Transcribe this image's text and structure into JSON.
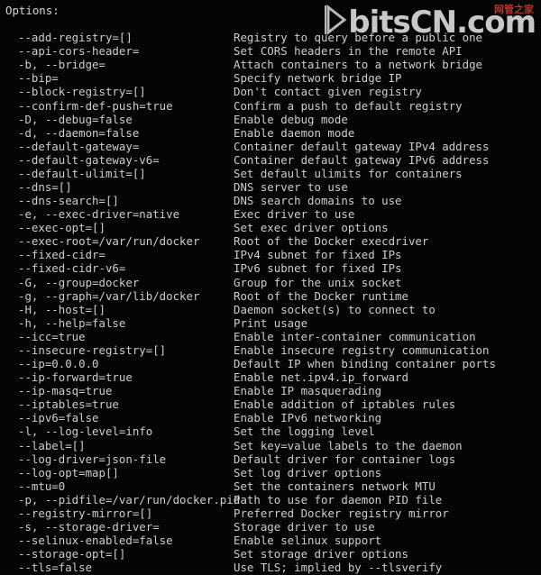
{
  "terminal": {
    "heading": "Options:",
    "blank_line": "",
    "options": [
      {
        "flag": "--add-registry=[]",
        "desc": "Registry to query before a public one"
      },
      {
        "flag": "--api-cors-header=",
        "desc": "Set CORS headers in the remote API"
      },
      {
        "flag": "-b, --bridge=",
        "desc": "Attach containers to a network bridge"
      },
      {
        "flag": "--bip=",
        "desc": "Specify network bridge IP"
      },
      {
        "flag": "--block-registry=[]",
        "desc": "Don't contact given registry"
      },
      {
        "flag": "--confirm-def-push=true",
        "desc": "Confirm a push to default registry"
      },
      {
        "flag": "-D, --debug=false",
        "desc": "Enable debug mode"
      },
      {
        "flag": "-d, --daemon=false",
        "desc": "Enable daemon mode"
      },
      {
        "flag": "--default-gateway=",
        "desc": "Container default gateway IPv4 address"
      },
      {
        "flag": "--default-gateway-v6=",
        "desc": "Container default gateway IPv6 address"
      },
      {
        "flag": "--default-ulimit=[]",
        "desc": "Set default ulimits for containers"
      },
      {
        "flag": "--dns=[]",
        "desc": "DNS server to use"
      },
      {
        "flag": "--dns-search=[]",
        "desc": "DNS search domains to use"
      },
      {
        "flag": "-e, --exec-driver=native",
        "desc": "Exec driver to use"
      },
      {
        "flag": "--exec-opt=[]",
        "desc": "Set exec driver options"
      },
      {
        "flag": "--exec-root=/var/run/docker",
        "desc": "Root of the Docker execdriver"
      },
      {
        "flag": "--fixed-cidr=",
        "desc": "IPv4 subnet for fixed IPs"
      },
      {
        "flag": "--fixed-cidr-v6=",
        "desc": "IPv6 subnet for fixed IPs"
      },
      {
        "flag": "-G, --group=docker",
        "desc": "Group for the unix socket"
      },
      {
        "flag": "-g, --graph=/var/lib/docker",
        "desc": "Root of the Docker runtime"
      },
      {
        "flag": "-H, --host=[]",
        "desc": "Daemon socket(s) to connect to"
      },
      {
        "flag": "-h, --help=false",
        "desc": "Print usage"
      },
      {
        "flag": "--icc=true",
        "desc": "Enable inter-container communication"
      },
      {
        "flag": "--insecure-registry=[]",
        "desc": "Enable insecure registry communication"
      },
      {
        "flag": "--ip=0.0.0.0",
        "desc": "Default IP when binding container ports"
      },
      {
        "flag": "--ip-forward=true",
        "desc": "Enable net.ipv4.ip_forward"
      },
      {
        "flag": "--ip-masq=true",
        "desc": "Enable IP masquerading"
      },
      {
        "flag": "--iptables=true",
        "desc": "Enable addition of iptables rules"
      },
      {
        "flag": "--ipv6=false",
        "desc": "Enable IPv6 networking"
      },
      {
        "flag": "-l, --log-level=info",
        "desc": "Set the logging level"
      },
      {
        "flag": "--label=[]",
        "desc": "Set key=value labels to the daemon"
      },
      {
        "flag": "--log-driver=json-file",
        "desc": "Default driver for container logs"
      },
      {
        "flag": "--log-opt=map[]",
        "desc": "Set log driver options"
      },
      {
        "flag": "--mtu=0",
        "desc": "Set the containers network MTU"
      },
      {
        "flag": "-p, --pidfile=/var/run/docker.pid",
        "desc": "Path to use for daemon PID file"
      },
      {
        "flag": "--registry-mirror=[]",
        "desc": "Preferred Docker registry mirror"
      },
      {
        "flag": "-s, --storage-driver=",
        "desc": "Storage driver to use"
      },
      {
        "flag": "--selinux-enabled=false",
        "desc": "Enable selinux support"
      },
      {
        "flag": "--storage-opt=[]",
        "desc": "Set storage driver options"
      },
      {
        "flag": "--tls=false",
        "desc": "Use TLS; implied by --tlsverify"
      }
    ]
  },
  "watermark": {
    "brand": "bitsCN",
    "tld": ".com",
    "chinese": "网管之家",
    "logo_icon": "play-triangle-icon",
    "accent_color": "#c0392b",
    "text_color": "#f2f2f2"
  },
  "colors": {
    "background": "#040404",
    "foreground": "#cdcdcd"
  }
}
